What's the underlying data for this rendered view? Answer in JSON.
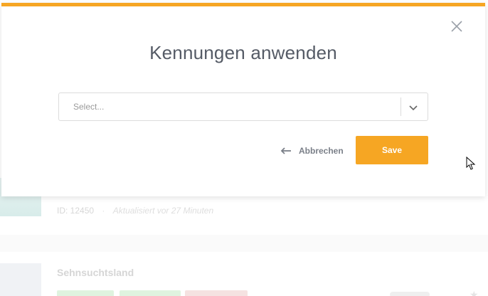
{
  "background": {
    "item_meta": {
      "id_text": "ID: 12450",
      "separator": "·",
      "updated_text": "Aktualisiert vor 27 Minuten"
    },
    "item_title": "Sehnsuchtsland"
  },
  "modal": {
    "title": "Kennungen anwenden",
    "select": {
      "placeholder": "Select..."
    },
    "cancel_label": "Abbrechen",
    "save_label": "Save",
    "accent_color": "#f6a623",
    "icons": {
      "close": "close-icon",
      "dropdown": "chevron-down-icon",
      "back": "arrow-left-icon"
    }
  }
}
